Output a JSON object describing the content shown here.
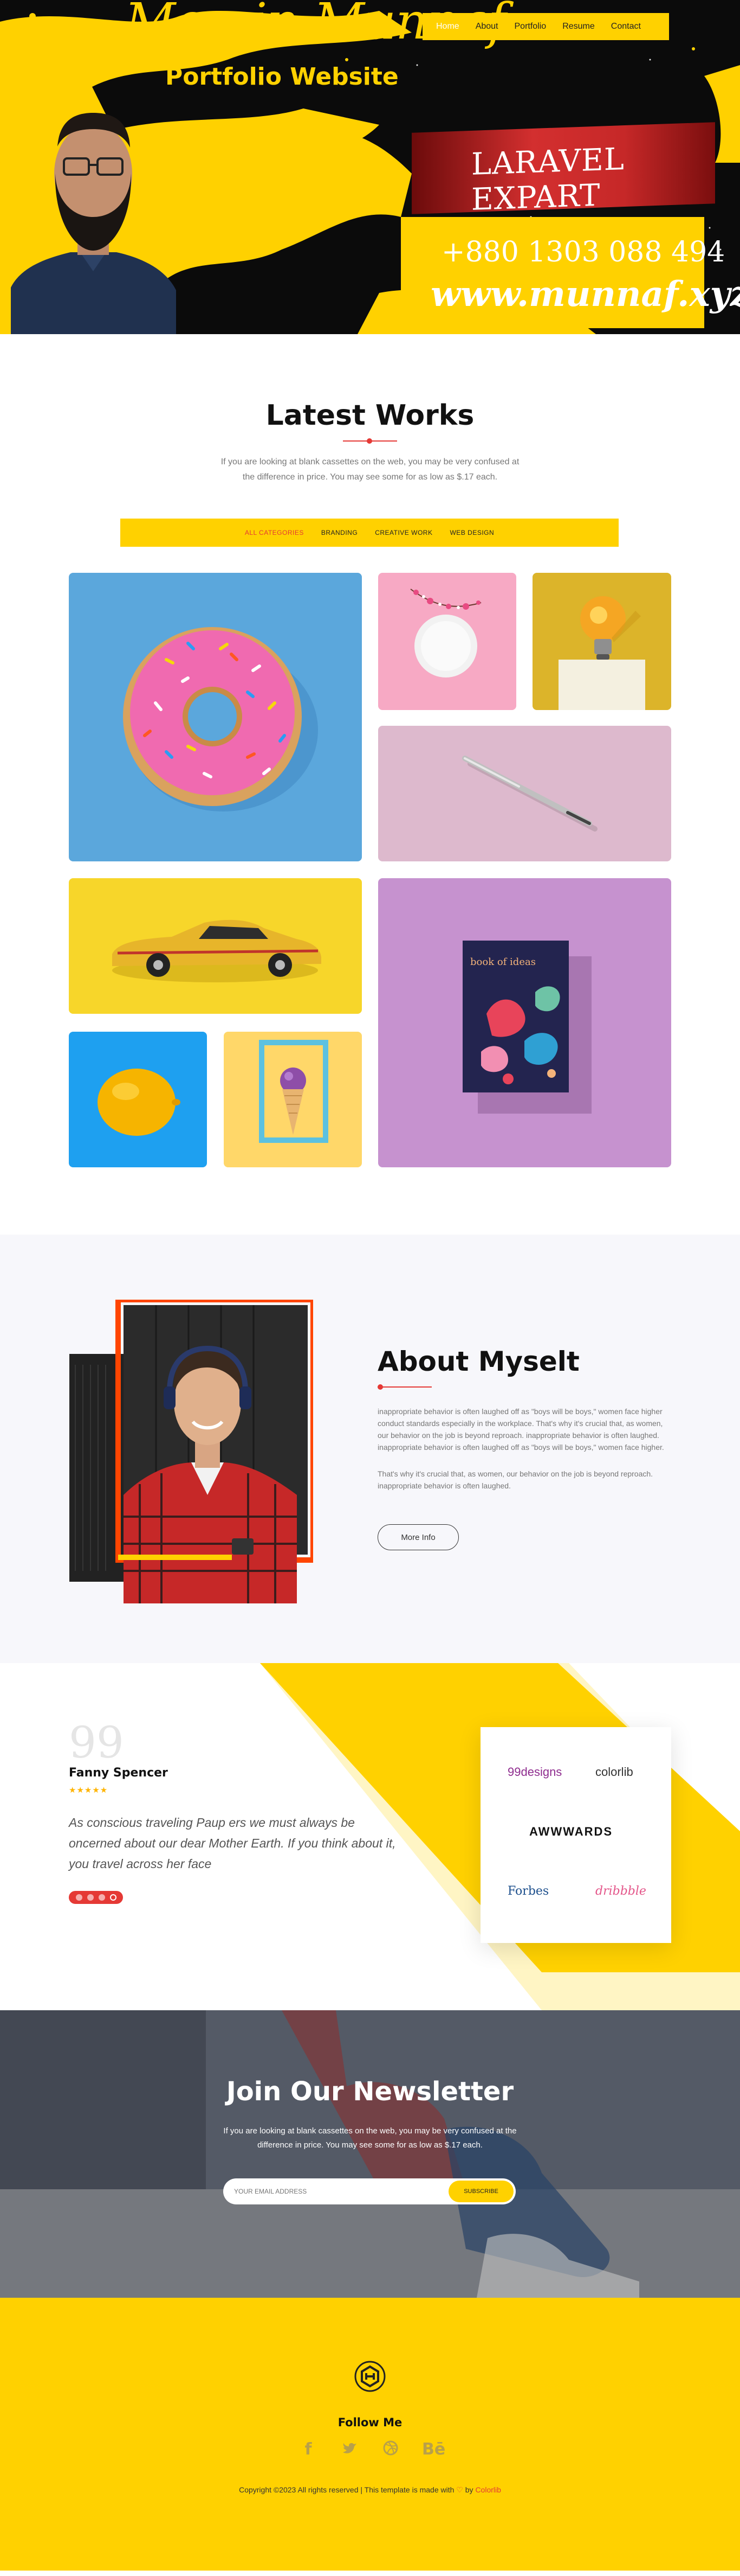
{
  "hero": {
    "name": "Momin Munnaf",
    "subtitle": "Portfolio Website",
    "badge": "LARAVEL EXPART",
    "phone": "+880 1303 088 494",
    "url": "www.munnaf.xyz",
    "nav": [
      "Home",
      "About",
      "Portfolio",
      "Resume",
      "Contact"
    ],
    "nav_active_index": 0
  },
  "works": {
    "title": "Latest Works",
    "desc": "If you are looking at blank cassettes on the web, you may be very confused at the difference in price. You may see some for as low as $.17 each.",
    "filters": [
      "ALL CATEGORIES",
      "BRANDING",
      "CREATIVE WORK",
      "WEB DESIGN"
    ],
    "filter_active_index": 0,
    "tiles": [
      "donut",
      "flower-plate",
      "lightbulb",
      "pen",
      "toy-car",
      "book-of-ideas",
      "lemon",
      "ice-cream-frame"
    ],
    "book_text": "book of ideas"
  },
  "about": {
    "title": "About Myselt",
    "p1": "inappropriate behavior is often laughed off as \"boys will be boys,\" women face higher conduct standards especially in the workplace. That's why it's crucial that, as women, our behavior on the job is beyond reproach. inappropriate behavior is often laughed. inappropriate behavior is often laughed off as \"boys will be boys,\" women face higher.",
    "p2": "That's why it's crucial that, as women, our behavior on the job is beyond reproach. inappropriate behavior is often laughed.",
    "button": "More Info"
  },
  "testimonial": {
    "quote_mark": "99",
    "name": "Fanny Spencer",
    "stars": "★★★★★",
    "rating": 5,
    "text": "As conscious traveling Paup ers we must always be oncerned about our dear Mother Earth. If you think about it, you travel across her face",
    "dot_count": 4,
    "active_dot": 3,
    "brands": [
      "99designs",
      "colorlib",
      "AWWWARDS",
      "Forbes",
      "dribbble"
    ]
  },
  "newsletter": {
    "title": "Join Our Newsletter",
    "desc": "If you are looking at blank cassettes on the web, you may be very confused at the difference in price. You may see some for as low as $.17 each.",
    "placeholder": "YOUR EMAIL ADDRESS",
    "button": "SUBSCRIBE"
  },
  "footer": {
    "follow": "Follow Me",
    "socials": [
      "f",
      "t",
      "d",
      "Bē"
    ],
    "copyright_text": "Copyright ©2023 All rights reserved | This template is made with",
    "heart": "♡",
    "by": "by",
    "link": "Colorlib"
  },
  "colors": {
    "brand_yellow": "#ffd100",
    "accent_red": "#e53935",
    "dark": "#111111"
  }
}
